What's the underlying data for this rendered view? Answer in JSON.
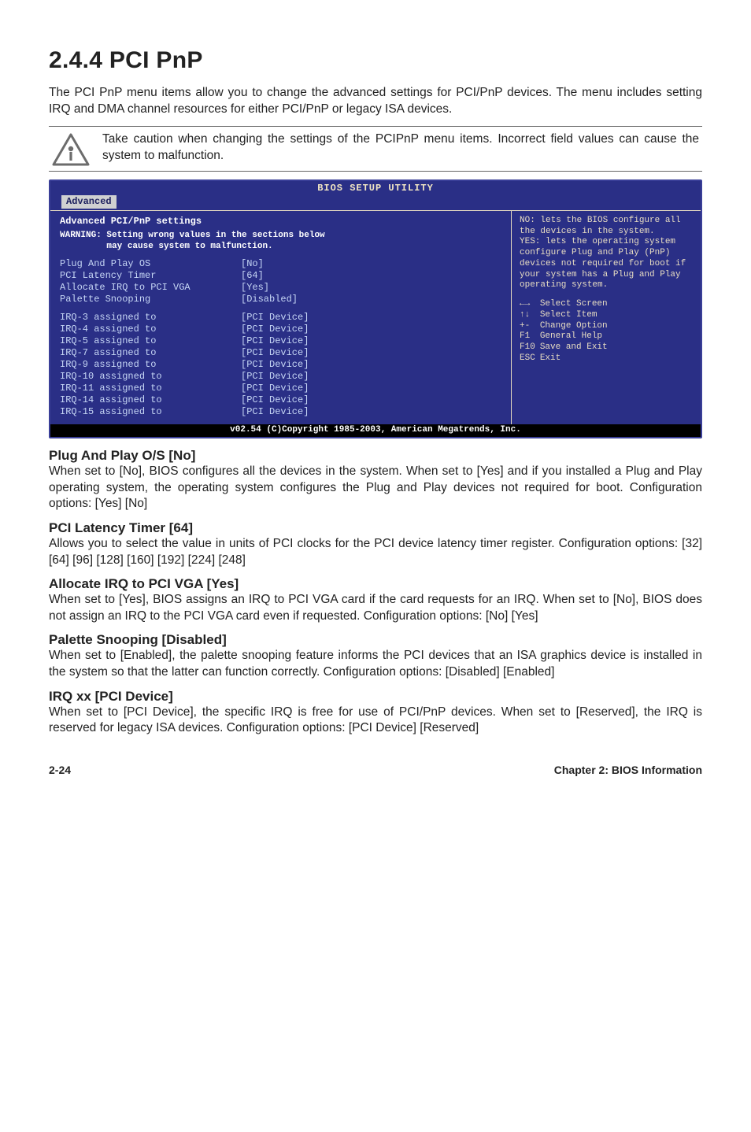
{
  "title": "2.4.4   PCI PnP",
  "intro": "The PCI PnP menu items allow you to change the advanced settings for PCI/PnP devices. The menu includes setting IRQ and DMA channel resources for either PCI/PnP or legacy ISA devices.",
  "callout": "Take caution when changing the settings of the PCIPnP menu items. Incorrect field values can cause the system to malfunction.",
  "bios": {
    "window_title": "BIOS SETUP UTILITY",
    "tab": "Advanced",
    "panel_title": "Advanced PCI/PnP settings",
    "warning": "WARNING: Setting wrong values in the sections below\n         may cause system to malfunction.",
    "rows_top": [
      {
        "k": "Plug And Play OS",
        "v": "[No]"
      },
      {
        "k": "PCI Latency Timer",
        "v": "[64]"
      },
      {
        "k": "Allocate IRQ to PCI VGA",
        "v": "[Yes]"
      },
      {
        "k": "Palette Snooping",
        "v": "[Disabled]"
      }
    ],
    "rows_irq": [
      {
        "k": "IRQ-3 assigned to",
        "v": "[PCI Device]"
      },
      {
        "k": "IRQ-4 assigned to",
        "v": "[PCI Device]"
      },
      {
        "k": "IRQ-5 assigned to",
        "v": "[PCI Device]"
      },
      {
        "k": "IRQ-7 assigned to",
        "v": "[PCI Device]"
      },
      {
        "k": "IRQ-9 assigned to",
        "v": "[PCI Device]"
      },
      {
        "k": "IRQ-10 assigned to",
        "v": "[PCI Device]"
      },
      {
        "k": "IRQ-11 assigned to",
        "v": "[PCI Device]"
      },
      {
        "k": "IRQ-14 assigned to",
        "v": "[PCI Device]"
      },
      {
        "k": "IRQ-15 assigned to",
        "v": "[PCI Device]"
      }
    ],
    "help": "NO: lets the BIOS configure all the devices in the system.\nYES: lets the operating system configure Plug and Play (PnP) devices not required for boot if your system has a Plug and Play operating system.",
    "keys": [
      {
        "key": "←→",
        "label": "Select Screen"
      },
      {
        "key": "↑↓",
        "label": "Select Item"
      },
      {
        "key": "+-",
        "label": "Change Option"
      },
      {
        "key": "F1",
        "label": "General Help"
      },
      {
        "key": "F10",
        "label": "Save and Exit"
      },
      {
        "key": "ESC",
        "label": "Exit"
      }
    ],
    "footer": "v02.54 (C)Copyright 1985-2003, American Megatrends, Inc."
  },
  "sections": [
    {
      "head": "Plug And Play O/S [No]",
      "body": "When set to [No], BIOS configures all the devices in the system. When set to [Yes] and if you installed a Plug and Play operating system, the operating system configures the Plug and Play devices not required for boot. Configuration options: [Yes] [No]"
    },
    {
      "head": "PCI Latency Timer [64]",
      "body": "Allows you to select the value in units of PCI clocks for the PCI device latency timer register. Configuration options: [32] [64] [96] [128] [160] [192] [224] [248]"
    },
    {
      "head": "Allocate IRQ to PCI VGA [Yes]",
      "body": "When set to [Yes], BIOS assigns an IRQ to PCI VGA card if the card requests for an IRQ. When set to [No], BIOS does not assign an IRQ to the PCI VGA card even if requested. Configuration options: [No] [Yes]"
    },
    {
      "head": "Palette Snooping [Disabled]",
      "body": "When set to [Enabled], the palette snooping feature informs the PCI devices that an ISA graphics device is installed in the system so that the latter can function correctly. Configuration options: [Disabled] [Enabled]"
    },
    {
      "head": "IRQ xx [PCI Device]",
      "body": "When set to [PCI Device], the specific IRQ is free for use of PCI/PnP devices. When set to [Reserved], the IRQ is reserved for legacy ISA devices. Configuration options: [PCI Device] [Reserved]"
    }
  ],
  "footer_left": "2-24",
  "footer_right": "Chapter 2: BIOS Information"
}
